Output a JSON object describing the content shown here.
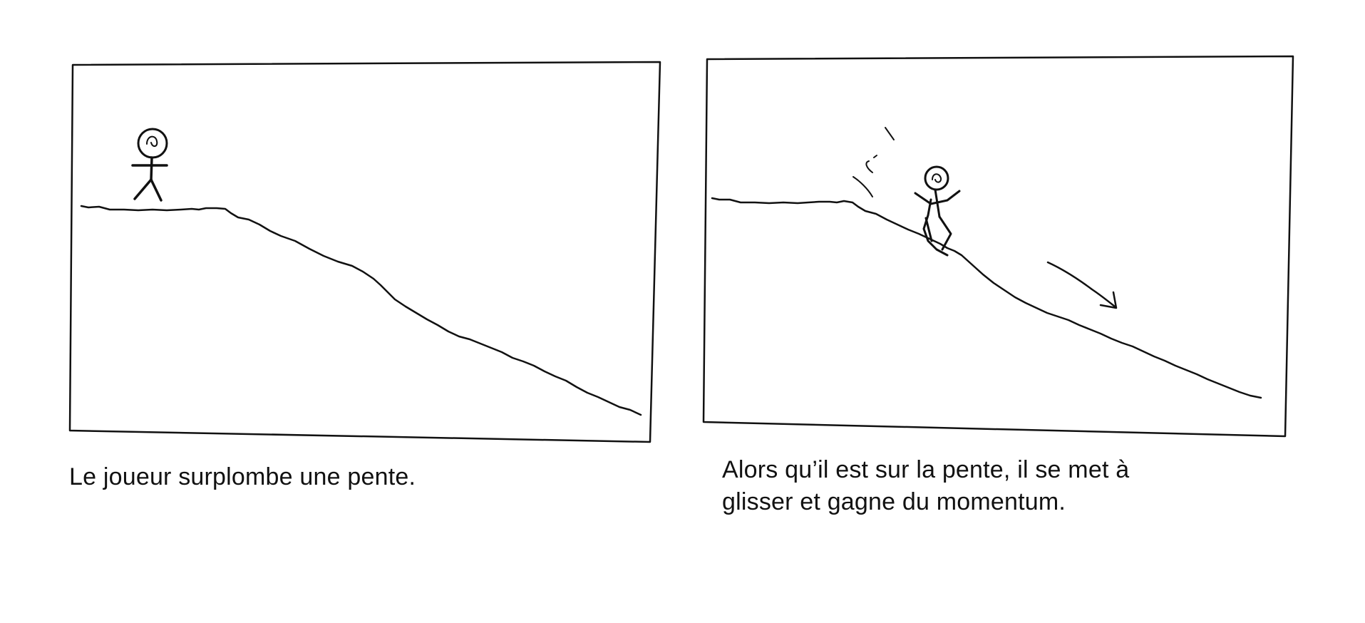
{
  "panels": [
    {
      "id": "panel-1",
      "caption": "Le joueur surplombe une pente."
    },
    {
      "id": "panel-2",
      "caption_lines": [
        "Alors qu’il est sur la pente, il se met à",
        "glisser et gagne du momentum."
      ]
    }
  ],
  "colors": {
    "ink": "#111111",
    "background": "#ffffff"
  }
}
